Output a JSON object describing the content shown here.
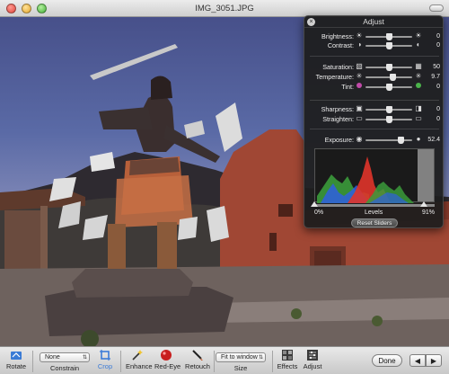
{
  "window": {
    "title": "IMG_3051.JPG"
  },
  "adjust_panel": {
    "title": "Adjust",
    "close_icon": "x-circle-icon",
    "rows": [
      {
        "label": "Brightness:",
        "left_icon": "sun-small-icon",
        "right_icon": "sun-large-icon",
        "value": "0",
        "level": 0.5
      },
      {
        "label": "Contrast:",
        "left_icon": "contrast-low-icon",
        "right_icon": "contrast-high-icon",
        "value": "0",
        "level": 0.5
      },
      {
        "label": "Saturation:",
        "left_icon": "saturation-low-icon",
        "right_icon": "saturation-high-icon",
        "value": "50",
        "level": 0.5
      },
      {
        "label": "Temperature:",
        "left_icon": "cool-icon",
        "right_icon": "warm-icon",
        "value": "9.7",
        "level": 0.58
      },
      {
        "label": "Tint:",
        "left_icon": "magenta-dot-icon",
        "right_icon": "green-dot-icon",
        "value": "0",
        "level": 0.5
      },
      {
        "label": "Sharpness:",
        "left_icon": "soft-icon",
        "right_icon": "sharp-icon",
        "value": "0",
        "level": 0.5
      },
      {
        "label": "Straighten:",
        "left_icon": "tilt-left-icon",
        "right_icon": "tilt-right-icon",
        "value": "0",
        "level": 0.5
      },
      {
        "label": "Exposure:",
        "left_icon": "exposure-low-icon",
        "right_icon": "exposure-high-icon",
        "value": "52.4",
        "level": 0.75
      }
    ],
    "levels": {
      "label": "Levels",
      "low": "0%",
      "high": "91%",
      "low_level": 0.0,
      "high_level": 0.91
    },
    "reset_label": "Reset Sliders"
  },
  "toolbar": {
    "rotate_label": "Rotate",
    "constrain_value": "None",
    "constrain_label": "Constrain",
    "crop_label": "Crop",
    "enhance_label": "Enhance",
    "redeye_label": "Red-Eye",
    "retouch_label": "Retouch",
    "size_value": "Fit to window",
    "size_label": "Size",
    "effects_label": "Effects",
    "adjust_label": "Adjust",
    "done_label": "Done",
    "prev_icon": "arrow-left-icon",
    "next_icon": "arrow-right-icon"
  },
  "colors": {
    "sky": "#5562a0",
    "adobe_wall": "#a24a35",
    "hud_bg": "#1e1e1e",
    "crop_accent": "#3b7bd8"
  }
}
